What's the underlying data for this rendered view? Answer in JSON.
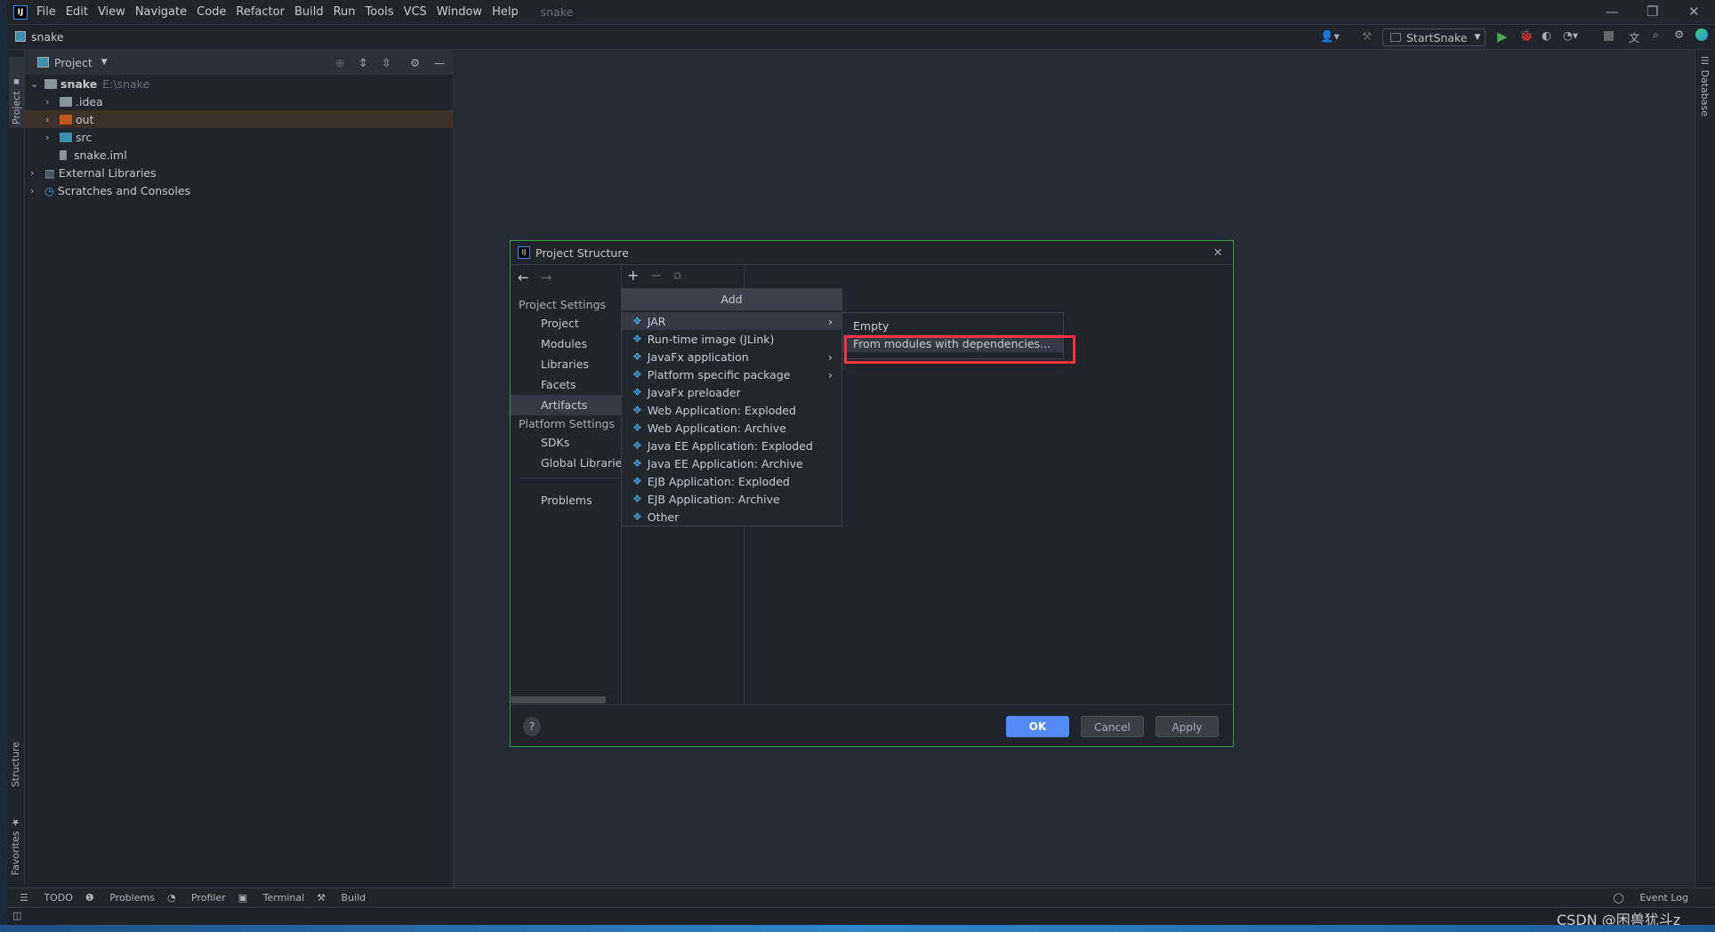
{
  "menubar": {
    "items": [
      "File",
      "Edit",
      "View",
      "Navigate",
      "Code",
      "Refactor",
      "Build",
      "Run",
      "Tools",
      "VCS",
      "Window",
      "Help"
    ],
    "window_title": "snake"
  },
  "navbar": {
    "project": "snake",
    "run_config": "StartSnake"
  },
  "tool_strips": {
    "left_top": "Project",
    "left_structure": "Structure",
    "left_favorites": "Favorites",
    "right": "Database"
  },
  "project_panel": {
    "title": "Project",
    "tree": [
      {
        "label": "snake",
        "hint": "E:\\snake",
        "icon": "module-folder-icon"
      },
      {
        "label": ".idea",
        "icon": "folder-icon"
      },
      {
        "label": "out",
        "icon": "excluded-folder-icon"
      },
      {
        "label": "src",
        "icon": "source-folder-icon"
      },
      {
        "label": "snake.iml",
        "icon": "file-icon"
      },
      {
        "label": "External Libraries",
        "icon": "libraries-icon"
      },
      {
        "label": "Scratches and Consoles",
        "icon": "scratches-icon"
      }
    ]
  },
  "dialog": {
    "title": "Project Structure",
    "nav": {
      "project_settings": "Project Settings",
      "project_items": [
        "Project",
        "Modules",
        "Libraries",
        "Facets",
        "Artifacts"
      ],
      "selected": "Artifacts",
      "platform_settings": "Platform Settings",
      "platform_items": [
        "SDKs",
        "Global Libraries"
      ],
      "problems": "Problems"
    },
    "add_popup": {
      "header": "Add",
      "items": [
        "JAR",
        "Run-time image (JLink)",
        "JavaFx application",
        "Platform specific package",
        "JavaFx preloader",
        "Web Application: Exploded",
        "Web Application: Archive",
        "Java EE Application: Exploded",
        "Java EE Application: Archive",
        "EJB Application: Exploded",
        "EJB Application: Archive",
        "Other"
      ]
    },
    "submenu": {
      "items": [
        "Empty",
        "From modules with dependencies..."
      ]
    },
    "buttons": {
      "help": "?",
      "ok": "OK",
      "cancel": "Cancel",
      "apply": "Apply"
    }
  },
  "bottom_bar": {
    "tabs": [
      "TODO",
      "Problems",
      "Profiler",
      "Terminal",
      "Build"
    ],
    "event_log": "Event Log"
  },
  "watermark": "CSDN @困兽犹斗z",
  "colors": {
    "accent": "#548af7",
    "highlight_box": "#f5333f",
    "excluded_folder": "#c4561c",
    "source_folder": "#3d8fb0"
  }
}
